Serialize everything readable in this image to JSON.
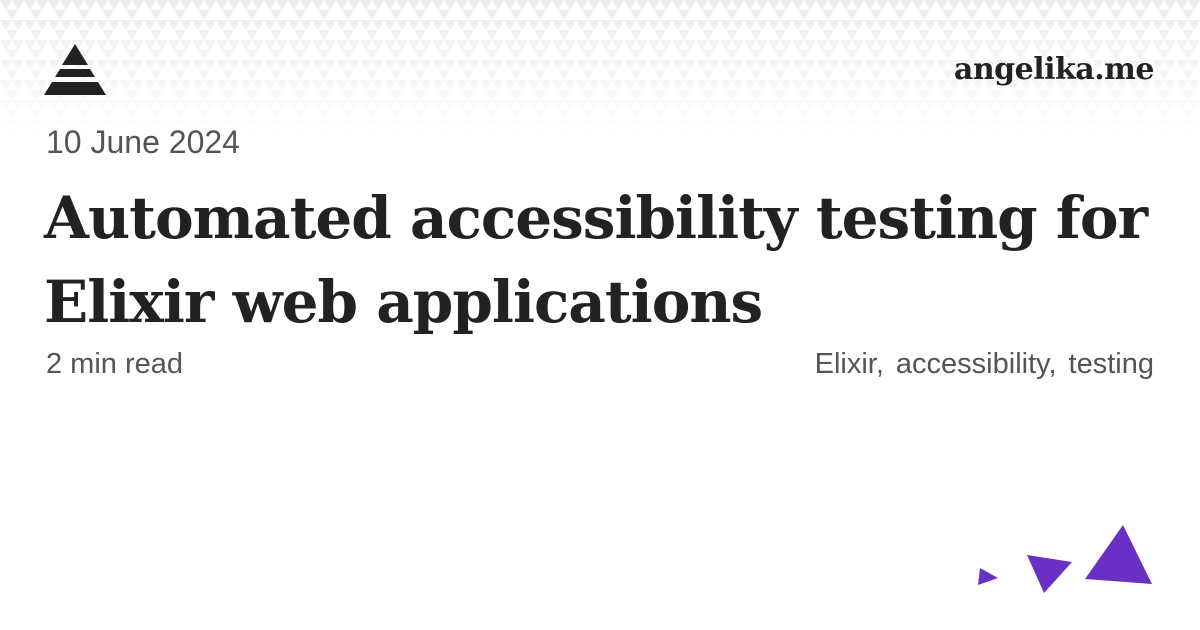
{
  "header": {
    "logo_icon": "stacked-triangle-logo-icon",
    "site_name": "angelika.me"
  },
  "post": {
    "date": "10 June 2024",
    "title": "Automated accessibility testing for Elixir web applications",
    "read_time": "2 min read",
    "tags": [
      "Elixir",
      "accessibility",
      "testing"
    ]
  },
  "colors": {
    "text": "#222222",
    "muted": "#555555",
    "pattern": "#eeeeee",
    "accent": "#6a2fc4"
  }
}
